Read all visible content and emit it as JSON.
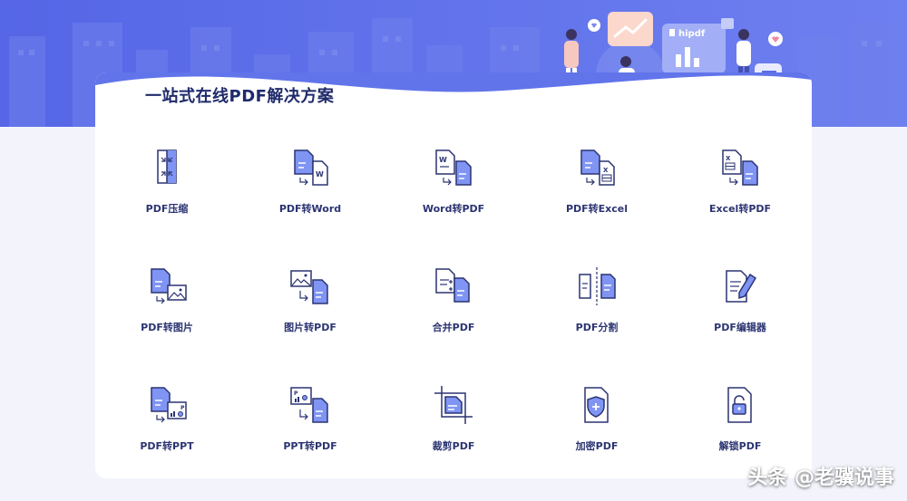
{
  "section": {
    "title": "一站式在线PDF解决方案"
  },
  "brand": {
    "logo_text": "hipdf"
  },
  "tools": [
    {
      "label": "PDF压缩",
      "icon": "compress-icon"
    },
    {
      "label": "PDF转Word",
      "icon": "pdf-to-word-icon"
    },
    {
      "label": "Word转PDF",
      "icon": "word-to-pdf-icon"
    },
    {
      "label": "PDF转Excel",
      "icon": "pdf-to-excel-icon"
    },
    {
      "label": "Excel转PDF",
      "icon": "excel-to-pdf-icon"
    },
    {
      "label": "PDF转图片",
      "icon": "pdf-to-image-icon"
    },
    {
      "label": "图片转PDF",
      "icon": "image-to-pdf-icon"
    },
    {
      "label": "合并PDF",
      "icon": "merge-icon"
    },
    {
      "label": "PDF分割",
      "icon": "split-icon"
    },
    {
      "label": "PDF编辑器",
      "icon": "editor-icon"
    },
    {
      "label": "PDF转PPT",
      "icon": "pdf-to-ppt-icon"
    },
    {
      "label": "PPT转PDF",
      "icon": "ppt-to-pdf-icon"
    },
    {
      "label": "裁剪PDF",
      "icon": "crop-icon"
    },
    {
      "label": "加密PDF",
      "icon": "encrypt-icon"
    },
    {
      "label": "解锁PDF",
      "icon": "unlock-icon"
    }
  ],
  "watermark": {
    "text": "头条 @老骥说事"
  },
  "colors": {
    "primary": "#5b6ee8",
    "dark": "#2b3472",
    "light": "#dfe5fc"
  }
}
